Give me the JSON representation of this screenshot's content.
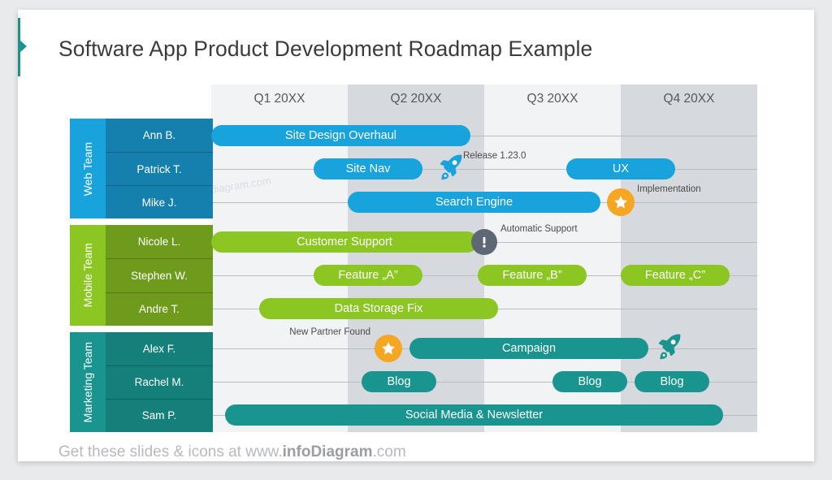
{
  "slide": {
    "title": "Software App Product Development Roadmap Example",
    "watermark": "infodiagram.com",
    "footer_prefix": "Get these slides & icons at www.",
    "footer_brand": "infoDiagram",
    "footer_suffix": ".com"
  },
  "colors": {
    "web": "#18a3dc",
    "web_dark": "#1580ad",
    "mobile": "#8cc623",
    "mobile_dark": "#6f9b1d",
    "marketing": "#19948f",
    "marketing_dark": "#157f7a",
    "star": "#f5a623",
    "alert": "#5e6775",
    "accent": "#19948f",
    "column_light": "#f2f3f4",
    "column_dark": "#d6d9de"
  },
  "chart_data": {
    "type": "table",
    "title": "Software App Product Development Roadmap Example",
    "quarters": [
      "Q1 20XX",
      "Q2 20XX",
      "Q3 20XX",
      "Q4 20XX"
    ],
    "teams": [
      {
        "name": "Web Team",
        "color": "#18a3dc",
        "members": [
          "Ann B.",
          "Patrick T.",
          "Mike J."
        ]
      },
      {
        "name": "Mobile Team",
        "color": "#8cc623",
        "members": [
          "Nicole L.",
          "Stephen W.",
          "Andre T."
        ]
      },
      {
        "name": "Marketing Team",
        "color": "#19948f",
        "members": [
          "Alex F.",
          "Rachel M.",
          "Sam P."
        ]
      }
    ],
    "tasks": [
      {
        "label": "Site Design Overhaul",
        "team": "Web Team",
        "row": 0,
        "start_q": 1.0,
        "end_q": 2.9,
        "color": "#18a3dc"
      },
      {
        "label": "Site Nav",
        "team": "Web Team",
        "row": 1,
        "start_q": 1.75,
        "end_q": 2.55,
        "color": "#18a3dc"
      },
      {
        "label": "UX",
        "team": "Web Team",
        "row": 1,
        "start_q": 3.6,
        "end_q": 4.4,
        "color": "#18a3dc"
      },
      {
        "label": "Search Engine",
        "team": "Web Team",
        "row": 2,
        "start_q": 2.0,
        "end_q": 3.85,
        "color": "#18a3dc"
      },
      {
        "label": "Customer Support",
        "team": "Mobile Team",
        "row": 0,
        "start_q": 1.0,
        "end_q": 2.95,
        "color": "#8cc623"
      },
      {
        "label": "Feature „A”",
        "team": "Mobile Team",
        "row": 1,
        "start_q": 1.75,
        "end_q": 2.55,
        "color": "#8cc623"
      },
      {
        "label": "Feature „B”",
        "team": "Mobile Team",
        "row": 1,
        "start_q": 2.95,
        "end_q": 3.75,
        "color": "#8cc623"
      },
      {
        "label": "Feature „C”",
        "team": "Mobile Team",
        "row": 1,
        "start_q": 4.0,
        "end_q": 4.8,
        "color": "#8cc623"
      },
      {
        "label": "Data Storage Fix",
        "team": "Mobile Team",
        "row": 2,
        "start_q": 1.35,
        "end_q": 3.1,
        "color": "#8cc623"
      },
      {
        "label": "Campaign",
        "team": "Marketing Team",
        "row": 0,
        "start_q": 2.45,
        "end_q": 4.2,
        "color": "#19948f"
      },
      {
        "label": "Blog",
        "team": "Marketing Team",
        "row": 1,
        "start_q": 2.1,
        "end_q": 2.65,
        "color": "#19948f"
      },
      {
        "label": "Blog",
        "team": "Marketing Team",
        "row": 1,
        "start_q": 3.5,
        "end_q": 4.05,
        "color": "#19948f"
      },
      {
        "label": "Blog",
        "team": "Marketing Team",
        "row": 1,
        "start_q": 4.1,
        "end_q": 4.65,
        "color": "#19948f"
      },
      {
        "label": "Social Media & Newsletter",
        "team": "Marketing Team",
        "row": 2,
        "start_q": 1.1,
        "end_q": 4.75,
        "color": "#19948f"
      }
    ],
    "milestones": [
      {
        "label": "Release 1.23.0",
        "icon": "rocket-icon",
        "team": "Web Team",
        "row": 1,
        "at_q": 2.75,
        "color": "#18a3dc"
      },
      {
        "label": "Implementation",
        "icon": "star-icon",
        "team": "Web Team",
        "row": 2,
        "at_q": 4.0,
        "color": "#f5a623"
      },
      {
        "label": "Automatic Support",
        "icon": "alert-icon",
        "team": "Mobile Team",
        "row": 0,
        "at_q": 3.0,
        "color": "#5e6775"
      },
      {
        "label": "New Partner Found",
        "icon": "star-icon",
        "team": "Marketing Team",
        "row": 0,
        "at_q": 2.3,
        "color": "#f5a623"
      },
      {
        "label": "",
        "icon": "rocket-icon",
        "team": "Marketing Team",
        "row": 0,
        "at_q": 4.35,
        "color": "#19948f"
      }
    ]
  }
}
